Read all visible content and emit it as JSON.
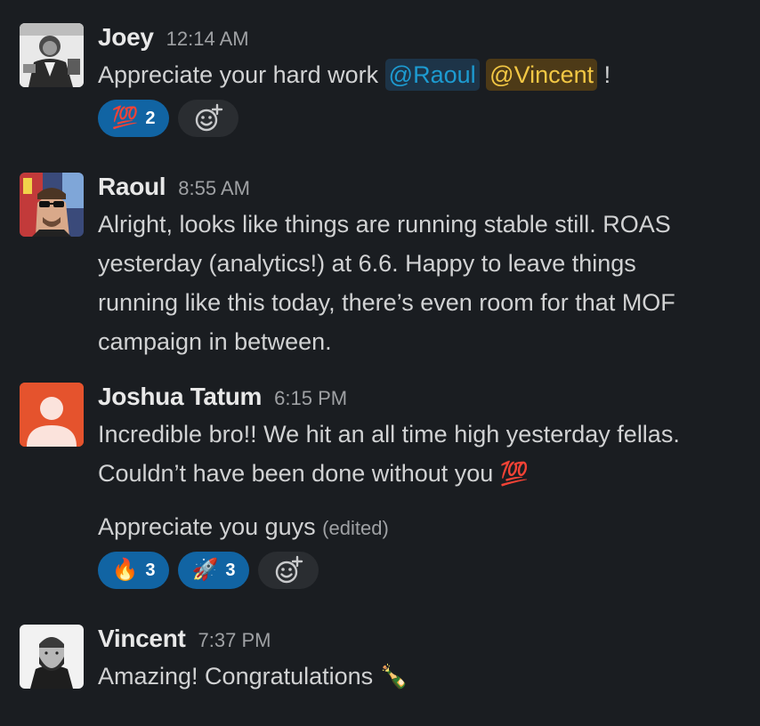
{
  "messages": [
    {
      "author": "Joey",
      "time": "12:14 AM",
      "text_before": "Appreciate your hard work",
      "mention1": "@Raoul",
      "mention2": "@Vincent",
      "text_after": "!",
      "reactions": [
        {
          "emoji": "💯",
          "count": "2",
          "icon": "hundred-points-icon"
        }
      ]
    },
    {
      "author": "Raoul",
      "time": "8:55 AM",
      "lines": [
        "Alright, looks like things are running stable still. ROAS",
        "yesterday (analytics!) at 6.6. Happy to leave things",
        "running like this today, there’s even room for that MOF",
        "campaign in between."
      ]
    },
    {
      "author": "Joshua Tatum",
      "time": "6:15 PM",
      "lines": [
        "Incredible bro!! We hit an all time high yesterday fellas.",
        "Couldn’t have been done without you"
      ],
      "inline_emoji": "💯",
      "followup": "Appreciate you guys",
      "edited": "(edited)",
      "reactions": [
        {
          "emoji": "🔥",
          "count": "3",
          "icon": "fire-icon"
        },
        {
          "emoji": "🚀",
          "count": "3",
          "icon": "rocket-icon"
        }
      ]
    },
    {
      "author": "Vincent",
      "time": "7:37 PM",
      "text": "Amazing! Congratulations",
      "inline_emoji": "🍾"
    }
  ],
  "colors": {
    "background": "#1a1d21",
    "reaction_active": "#1164a3",
    "mention_blue": "#1d9bd1",
    "mention_gold": "#f2c744",
    "default_avatar": "#e5532d"
  }
}
